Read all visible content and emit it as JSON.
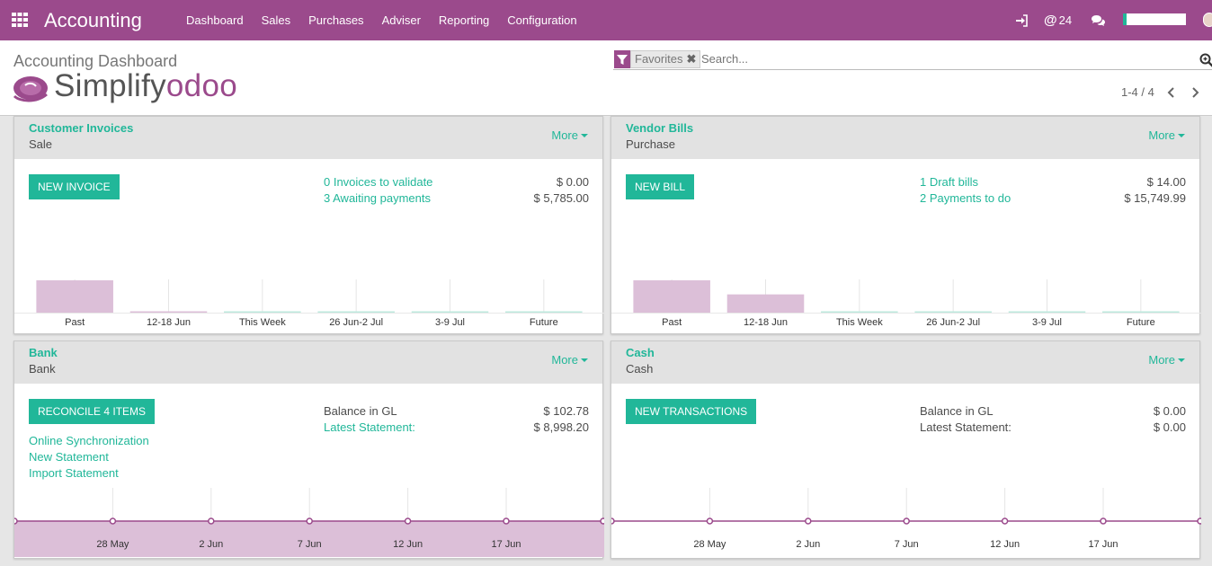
{
  "topbar": {
    "app_title": "Accounting",
    "menu": [
      "Dashboard",
      "Sales",
      "Purchases",
      "Adviser",
      "Reporting",
      "Configuration"
    ],
    "login_icon": "sign-in-icon",
    "mentions_count": "24",
    "chat_icon": "comments-icon",
    "accent": "#9b4a8c"
  },
  "control": {
    "breadcrumb": "Accounting Dashboard",
    "logo_text_a": "Simplify",
    "logo_text_b": "odoo",
    "facet_label": "Favorites",
    "search_placeholder": "Search...",
    "pager": "1-4 / 4"
  },
  "cards": [
    {
      "name": "Customer Invoices",
      "type": "Sale",
      "more": "More",
      "button": "New Invoice",
      "rows": [
        {
          "text": "0 Invoices to validate",
          "link": true,
          "amount": "$ 0.00"
        },
        {
          "text": "3 Awaiting payments",
          "link": true,
          "amount": "$ 5,785.00"
        }
      ],
      "actions": []
    },
    {
      "name": "Vendor Bills",
      "type": "Purchase",
      "more": "More",
      "button": "New Bill",
      "rows": [
        {
          "text": "1 Draft bills",
          "link": true,
          "amount": "$ 14.00"
        },
        {
          "text": "2 Payments to do",
          "link": true,
          "amount": "$ 15,749.99"
        }
      ],
      "actions": []
    },
    {
      "name": "Bank",
      "type": "Bank",
      "more": "More",
      "button": "Reconcile 4 Items",
      "rows": [
        {
          "text": "Balance in GL",
          "link": false,
          "amount": "$ 102.78"
        },
        {
          "text": "Latest Statement:",
          "link": true,
          "amount": "$ 8,998.20"
        }
      ],
      "actions": [
        "Online Synchronization",
        "New Statement",
        "Import Statement"
      ]
    },
    {
      "name": "Cash",
      "type": "Cash",
      "more": "More",
      "button": "New Transactions",
      "rows": [
        {
          "text": "Balance in GL",
          "link": false,
          "amount": "$ 0.00"
        },
        {
          "text": "Latest Statement:",
          "link": false,
          "amount": "$ 0.00"
        }
      ],
      "actions": []
    }
  ],
  "chart_data": [
    {
      "type": "bar",
      "categories": [
        "Past",
        "12-18 Jun",
        "This Week",
        "26 Jun-2 Jul",
        "3-9 Jul",
        "Future"
      ],
      "values": [
        5785,
        0,
        0,
        0,
        0,
        0
      ],
      "colors": [
        "#dcbfd8",
        "#dcbfd8",
        "#bde9de",
        "#bde9de",
        "#bde9de",
        "#bde9de"
      ]
    },
    {
      "type": "bar",
      "categories": [
        "Past",
        "12-18 Jun",
        "This Week",
        "26 Jun-2 Jul",
        "3-9 Jul",
        "Future"
      ],
      "values": [
        15749.99,
        8900,
        0,
        0,
        0,
        0
      ],
      "colors": [
        "#dcbfd8",
        "#dcbfd8",
        "#bde9de",
        "#bde9de",
        "#bde9de",
        "#bde9de"
      ]
    },
    {
      "type": "area",
      "x_labels": [
        "28 May",
        "2 Jun",
        "7 Jun",
        "12 Jun",
        "17 Jun"
      ],
      "values": [
        102.78,
        102.78,
        102.78,
        102.78,
        102.78,
        102.78,
        102.78
      ],
      "line_color": "#9b4a8c",
      "fill_color": "#dcbfd8"
    },
    {
      "type": "line",
      "x_labels": [
        "28 May",
        "2 Jun",
        "7 Jun",
        "12 Jun",
        "17 Jun"
      ],
      "values": [
        0,
        0,
        0,
        0,
        0,
        0,
        0
      ],
      "line_color": "#9b4a8c"
    }
  ]
}
